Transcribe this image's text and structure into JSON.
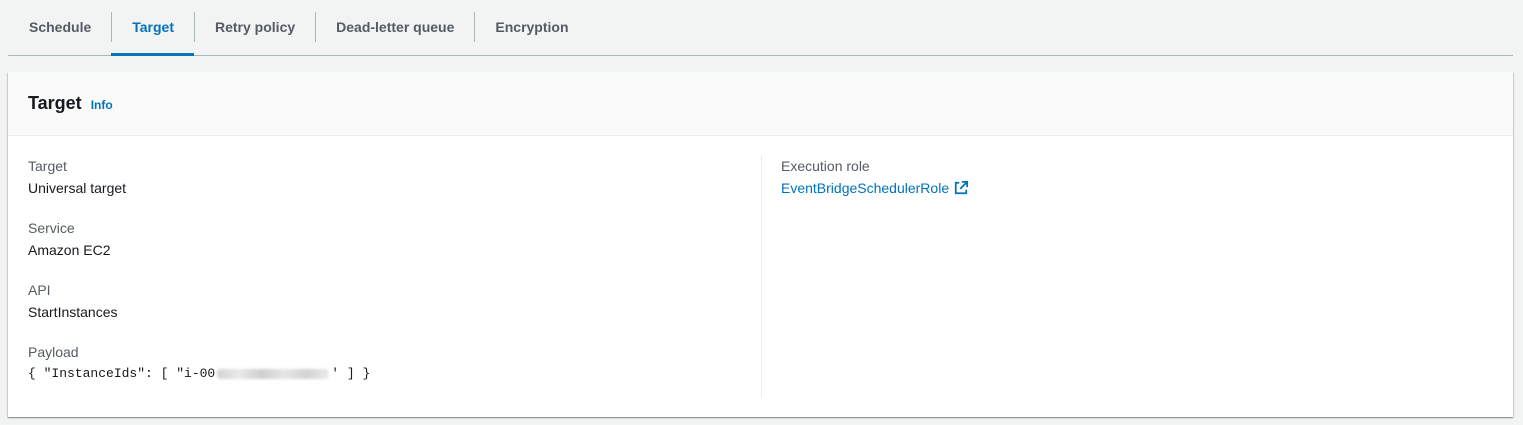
{
  "tabs": [
    {
      "label": "Schedule"
    },
    {
      "label": "Target"
    },
    {
      "label": "Retry policy"
    },
    {
      "label": "Dead-letter queue"
    },
    {
      "label": "Encryption"
    }
  ],
  "active_tab": "Target",
  "panel": {
    "title": "Target",
    "info_label": "Info"
  },
  "details": {
    "target": {
      "label": "Target",
      "value": "Universal target"
    },
    "service": {
      "label": "Service",
      "value": "Amazon EC2"
    },
    "api": {
      "label": "API",
      "value": "StartInstances"
    },
    "payload": {
      "label": "Payload",
      "prefix": "{ \"InstanceIds\": [ \"i-00",
      "suffix": "' ] }"
    },
    "execution_role": {
      "label": "Execution role",
      "value": "EventBridgeSchedulerRole",
      "icon": "external-link-icon"
    }
  },
  "colors": {
    "accent": "#0073bb",
    "text": "#16191f",
    "label": "#545b64"
  }
}
